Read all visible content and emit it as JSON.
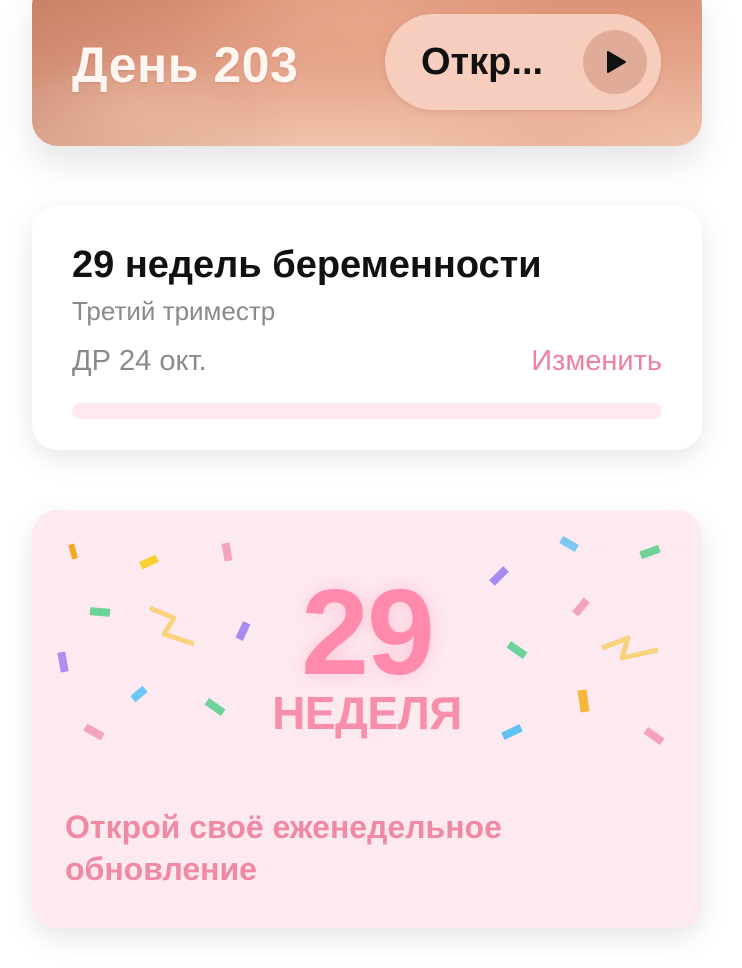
{
  "day_card": {
    "title": "День 203",
    "open_label": "Откр..."
  },
  "week_card": {
    "title": "29 недель беременности",
    "trimester": "Третий триместр",
    "due_date": "ДР 24 окт.",
    "change_label": "Изменить",
    "progress": 0
  },
  "update_card": {
    "number": "29",
    "week_word": "НЕДЕЛЯ",
    "text": "Открой своё еженедельное обновление"
  },
  "colors": {
    "accent_pink": "#f07fa0",
    "card_pink_bg": "#fdeaf0",
    "big_number": "#ff8aab"
  }
}
